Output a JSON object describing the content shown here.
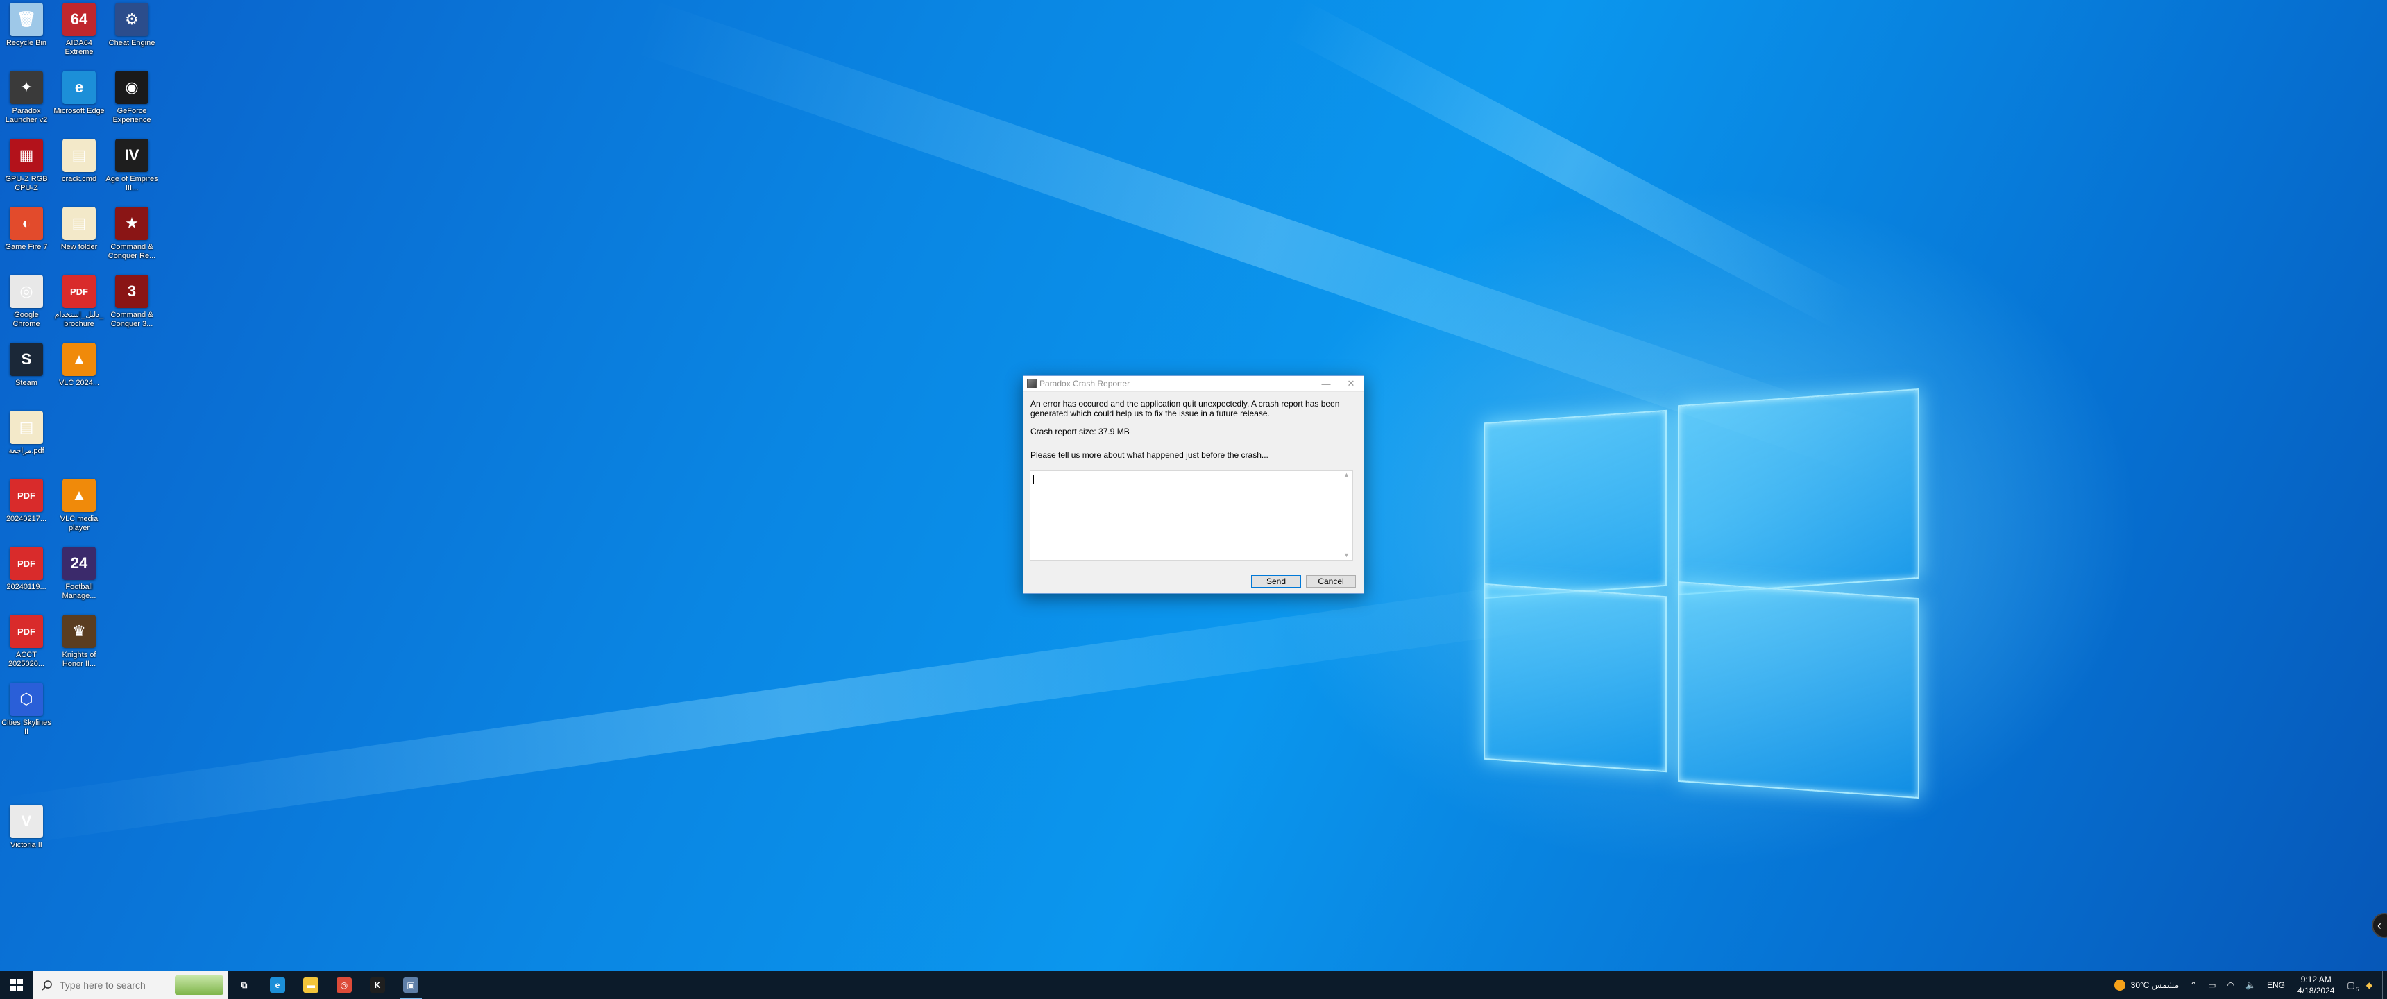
{
  "desktop": {
    "icons": [
      {
        "label": "Recycle Bin",
        "color": "#9ec8e8",
        "glyph": "🗑"
      },
      {
        "label": "AIDA64 Extreme",
        "color": "#c0272d",
        "glyph": "64"
      },
      {
        "label": "Cheat Engine",
        "color": "#2b4d8c",
        "glyph": "⚙"
      },
      {
        "label": "Paradox Launcher v2",
        "color": "#3a3a3a",
        "glyph": "✦"
      },
      {
        "label": "Microsoft Edge",
        "color": "#1c8fd8",
        "glyph": "e"
      },
      {
        "label": "GeForce Experience",
        "color": "#1a1a1a",
        "glyph": "◉"
      },
      {
        "label": "GPU-Z RGB CPU-Z",
        "color": "#b3121b",
        "glyph": "▦"
      },
      {
        "label": "crack.cmd",
        "color": "#f3e9c9",
        "glyph": "▤"
      },
      {
        "label": "Age of Empires III...",
        "color": "#1e1e1e",
        "glyph": "IV"
      },
      {
        "label": "Game Fire 7",
        "color": "#e24b2c",
        "glyph": "◐"
      },
      {
        "label": "New folder",
        "color": "#f3e9c9",
        "glyph": "▤"
      },
      {
        "label": "Command & Conquer Re...",
        "color": "#8a1515",
        "glyph": "★"
      },
      {
        "label": "Google Chrome",
        "color": "#e8e8e8",
        "glyph": "◎"
      },
      {
        "label": "دلیل_استخدام_brochure",
        "color": "#d92b2b",
        "glyph": "PDF"
      },
      {
        "label": "Command & Conquer 3...",
        "color": "#8a1515",
        "glyph": "3"
      },
      {
        "label": "Steam",
        "color": "#1b2838",
        "glyph": "S"
      },
      {
        "label": "VLC 2024...",
        "color": "#f08a0a",
        "glyph": "▲"
      },
      {
        "label": "مراجعة.pdf",
        "color": "#f3e9c9",
        "glyph": "▤"
      },
      {
        "label": "20240217...",
        "color": "#d92b2b",
        "glyph": "PDF"
      },
      {
        "label": "VLC media player",
        "color": "#f08a0a",
        "glyph": "▲"
      },
      {
        "label": "20240119...",
        "color": "#d92b2b",
        "glyph": "PDF"
      },
      {
        "label": "Football Manage...",
        "color": "#3b2a6b",
        "glyph": "24"
      },
      {
        "label": "ACCT 2025020...",
        "color": "#d92b2b",
        "glyph": "PDF"
      },
      {
        "label": "Knights of Honor II...",
        "color": "#5a3d20",
        "glyph": "♛"
      },
      {
        "label": "Cities Skylines II",
        "color": "#2a5fd8",
        "glyph": "⬡"
      },
      {
        "label": "Victoria II",
        "color": "#eaeaea",
        "glyph": "V"
      }
    ]
  },
  "dialog": {
    "title": "Paradox Crash Reporter",
    "minimize": "—",
    "close": "✕",
    "message": "An error has occured and the application quit unexpectedly. A crash report has been generated which could help us to fix the issue in a future release.",
    "size_text": "Crash report size: 37.9 MB",
    "prompt": "Please tell us more about what happened just before the crash...",
    "textarea_value": "",
    "send_label": "Send",
    "cancel_label": "Cancel"
  },
  "taskbar": {
    "search_placeholder": "Type here to search",
    "apps": [
      {
        "name": "task-view",
        "glyph": "⧉",
        "color": "transparent",
        "active": false
      },
      {
        "name": "edge",
        "glyph": "e",
        "color": "#1c8fd8",
        "active": false
      },
      {
        "name": "file-explorer",
        "glyph": "▬",
        "color": "#f3c53a",
        "active": false
      },
      {
        "name": "chrome",
        "glyph": "◎",
        "color": "#dd4b39",
        "active": false
      },
      {
        "name": "kaspersky",
        "glyph": "K",
        "color": "#1f1f1f",
        "active": false
      },
      {
        "name": "crash-reporter",
        "glyph": "▣",
        "color": "#5f7fa8",
        "active": true
      }
    ],
    "weather": "30°C  مشمس",
    "language": "ENG",
    "time": "9:12 AM",
    "date": "4/18/2024",
    "notification_count": "5"
  }
}
